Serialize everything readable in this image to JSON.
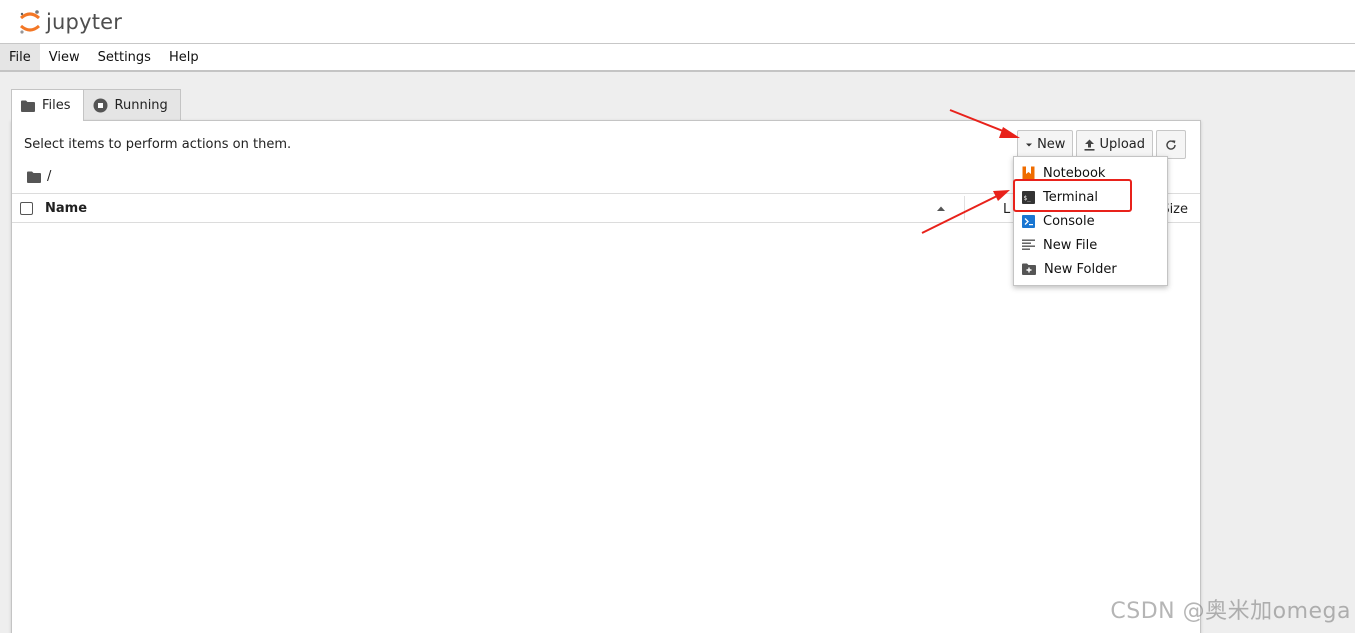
{
  "app": {
    "logo_text": "jupyter"
  },
  "menubar": {
    "items": [
      "File",
      "View",
      "Settings",
      "Help"
    ]
  },
  "tabs": [
    {
      "label": "Files",
      "icon": "folder-icon"
    },
    {
      "label": "Running",
      "icon": "stop-circle-icon"
    }
  ],
  "files_panel": {
    "hint": "Select items to perform actions on them.",
    "breadcrumb": "/",
    "toolbar": {
      "new_label": "New",
      "upload_label": "Upload",
      "refresh_icon": "refresh-icon"
    },
    "columns": {
      "name": "Name",
      "last_modified": "L",
      "size": "Size"
    }
  },
  "new_menu": {
    "items": [
      {
        "label": "Notebook",
        "icon": "notebook-icon"
      },
      {
        "label": "Terminal",
        "icon": "terminal-icon"
      },
      {
        "label": "Console",
        "icon": "console-icon"
      },
      {
        "label": "New File",
        "icon": "text-file-icon"
      },
      {
        "label": "New Folder",
        "icon": "new-folder-icon"
      }
    ],
    "highlighted": "Terminal"
  },
  "annotation": {
    "highlight_color": "#e8221b"
  },
  "watermark": "CSDN @奥米加omega",
  "colors": {
    "jupyter_orange": "#f37726",
    "console_blue": "#1976d2"
  }
}
